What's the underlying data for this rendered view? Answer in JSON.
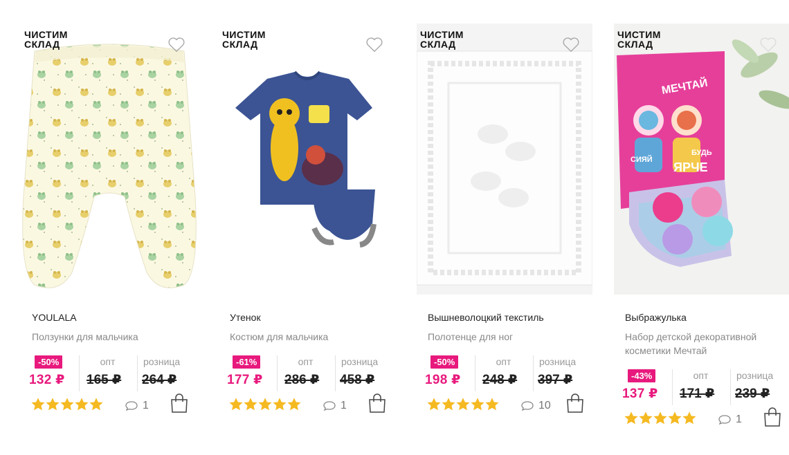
{
  "colors": {
    "accent": "#e8197d",
    "star": "#f5b921"
  },
  "products": [
    {
      "sale_badge": [
        "ЧИСТИМ",
        "СКЛАД"
      ],
      "brand": "YOULALA",
      "name": "Ползунки для мальчика",
      "discount": "-50%",
      "price_now": "132 ₽",
      "opt_label": "опт",
      "opt_price": "165 ₽",
      "retail_label": "розница",
      "retail_price": "264 ₽",
      "rating": 5,
      "comments": "1",
      "image": "pants-icon"
    },
    {
      "sale_badge": [
        "ЧИСТИМ",
        "СКЛАД"
      ],
      "brand": "Утенок",
      "name": "Костюм для мальчика",
      "discount": "-61%",
      "price_now": "177 ₽",
      "opt_label": "опт",
      "opt_price": "286 ₽",
      "retail_label": "розница",
      "retail_price": "458 ₽",
      "rating": 5,
      "comments": "1",
      "image": "tshirt-icon"
    },
    {
      "sale_badge": [
        "ЧИСТИМ",
        "СКЛАД"
      ],
      "brand": "Вышневолоцкий текстиль",
      "name": "Полотенце для ног",
      "discount": "-50%",
      "price_now": "198 ₽",
      "opt_label": "опт",
      "opt_price": "248 ₽",
      "retail_label": "розница",
      "retail_price": "397 ₽",
      "rating": 5,
      "comments": "10",
      "image": "towel-icon"
    },
    {
      "sale_badge": [
        "ЧИСТИМ",
        "СКЛАД"
      ],
      "brand": "Выбражулька",
      "name": "Набор детской декоративной косметики Мечтай",
      "discount": "-43%",
      "price_now": "137 ₽",
      "opt_label": "опт",
      "opt_price": "171 ₽",
      "retail_label": "розница",
      "retail_price": "239 ₽",
      "rating": 5,
      "comments": "1",
      "image": "cosmetics-palette-icon",
      "image_text": [
        "МЕЧТАЙ",
        "СИЯЙ",
        "БУДЬ",
        "ЯРЧЕ"
      ]
    }
  ]
}
